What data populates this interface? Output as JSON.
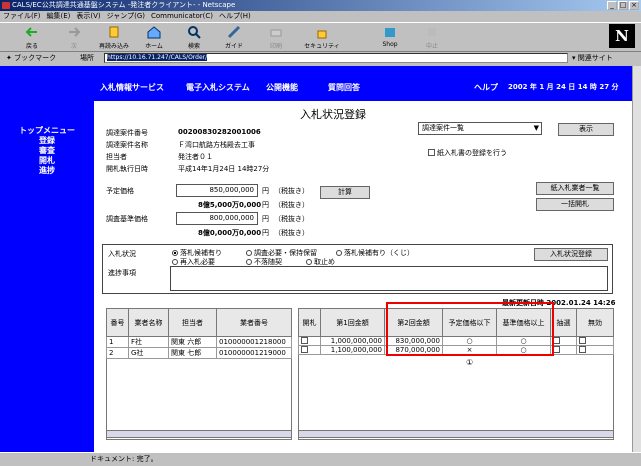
{
  "window": {
    "title": "CALS/EC公共調達共通基盤システム -発注者クライアント- - Netscape"
  },
  "menu": [
    "ファイル(F)",
    "編集(E)",
    "表示(V)",
    "ジャンプ(G)",
    "Communicator(C)",
    "ヘルプ(H)"
  ],
  "toolbar": [
    "戻る",
    "次",
    "再読み込み",
    "ホーム",
    "検索",
    "ガイド",
    "印刷",
    "セキュリティ",
    "Shop",
    "中止"
  ],
  "location": {
    "bookmarks": "ブックマーク",
    "label": "場所",
    "url": "https://10.16.71.247/CALS/Order/",
    "related": "関連サイト"
  },
  "nav": [
    "入札情報サービス",
    "電子入札システム",
    "公開機能",
    "質問回答",
    "ヘルプ"
  ],
  "datetime": {
    "year": "2002",
    "y": "年",
    "month": "1",
    "m": "月",
    "day": "24",
    "d": "日",
    "hour": "14",
    "h": "時",
    "min": "27",
    "mm": "分"
  },
  "sidebar": {
    "top": "トップメニュー",
    "items": [
      "登録",
      "審査",
      "開札",
      "進捗"
    ]
  },
  "page": {
    "title": "入札状況登録"
  },
  "info": {
    "labels": [
      "調達案件番号",
      "調達案件名称",
      "担当者",
      "開札執行日時"
    ],
    "values": [
      "00200830282001006",
      "Ｆ湾口航路方栈殿去工事",
      "発注者０１",
      "平成14年1月24日 14時27分"
    ]
  },
  "dropdown": {
    "value": "調達案件一覧"
  },
  "buttons": {
    "display": "表示",
    "calc": "計算",
    "paper_list": "紙入札業者一覧",
    "bulk_open": "一括開札",
    "register": "入札状況登録"
  },
  "paper_check": "紙入札書の登録を行う",
  "prices": {
    "planned_label": "予定価格",
    "planned_value": "850,000,000",
    "planned_kanji": "8億5,000万0,000",
    "unit": "円",
    "tax": "（税抜き）",
    "base_label": "調査基準価格",
    "base_value": "800,000,000",
    "base_kanji": "8億0,000万0,000"
  },
  "status": {
    "label": "入札状況",
    "notes_label": "進捗事項",
    "options": [
      "落札候補有り",
      "調査必要・保持保留",
      "落札候補有り（くじ）",
      "再入札必要",
      "不落随契",
      "取止め"
    ]
  },
  "updated": "最新更新日時 2002.01.24 14:26",
  "table": {
    "left_headers": [
      "番号",
      "業者名称",
      "担当者",
      "業者番号"
    ],
    "right_headers": [
      "開札",
      "第1回金額",
      "第2回金額",
      "予定価格以下",
      "基準価格以上",
      "抽選",
      "無効"
    ],
    "rows": [
      {
        "no": "1",
        "name": "F社",
        "person": "関東 六郎",
        "code": "010000001218000",
        "amt1": "1,000,000,000",
        "amt2": "830,000,000",
        "below": "○",
        "above": "○"
      },
      {
        "no": "2",
        "name": "G社",
        "person": "関東 七郎",
        "code": "010000001219000",
        "amt1": "1,100,000,000",
        "amt2": "870,000,000",
        "below": "×",
        "above": "○"
      }
    ],
    "marker": "①"
  },
  "statusbar": {
    "text": "ドキュメント: 完了。"
  }
}
